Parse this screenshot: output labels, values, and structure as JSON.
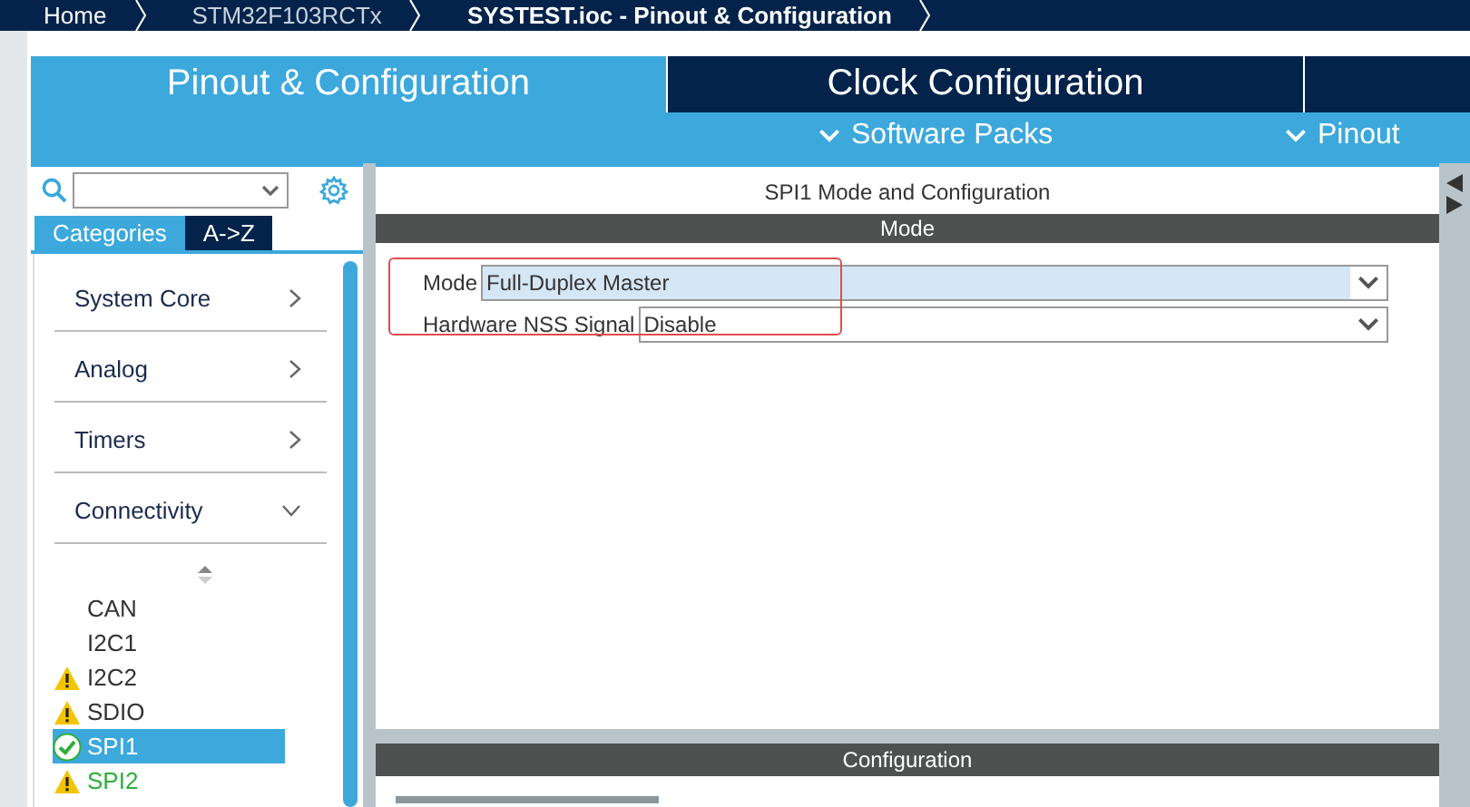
{
  "breadcrumbs": [
    {
      "label": "Home",
      "selected": false
    },
    {
      "label": "STM32F103RCTx",
      "selected": false
    },
    {
      "label": "SYSTEST.ioc - Pinout & Configuration",
      "selected": true
    }
  ],
  "tabs": [
    {
      "label": "Pinout & Configuration",
      "selected": true
    },
    {
      "label": "Clock Configuration",
      "selected": false
    }
  ],
  "menus": [
    "Software Packs",
    "Pinout"
  ],
  "sidebar": {
    "view_tabs": [
      {
        "label": "Categories",
        "selected": true
      },
      {
        "label": "A->Z",
        "selected": false
      }
    ],
    "categories": [
      {
        "label": "System Core",
        "expanded": false
      },
      {
        "label": "Analog",
        "expanded": false
      },
      {
        "label": "Timers",
        "expanded": false
      },
      {
        "label": "Connectivity",
        "expanded": true,
        "children": [
          {
            "label": "CAN",
            "warning": false,
            "ok": false,
            "configured": false,
            "selected": false
          },
          {
            "label": "I2C1",
            "warning": false,
            "ok": false,
            "configured": false,
            "selected": false
          },
          {
            "label": "I2C2",
            "warning": true,
            "ok": false,
            "configured": false,
            "selected": false
          },
          {
            "label": "SDIO",
            "warning": true,
            "ok": false,
            "configured": false,
            "selected": false
          },
          {
            "label": "SPI1",
            "warning": false,
            "ok": true,
            "configured": true,
            "selected": true
          },
          {
            "label": "SPI2",
            "warning": true,
            "ok": false,
            "configured": true,
            "selected": false
          }
        ]
      }
    ]
  },
  "panel": {
    "title": "SPI1 Mode and Configuration",
    "mode_section": {
      "title": "Mode",
      "fields": [
        {
          "label": "Mode",
          "value": "Full-Duplex Master",
          "highlighted": true
        },
        {
          "label": "Hardware NSS Signal",
          "value": "Disable",
          "highlighted": false
        }
      ]
    },
    "config_section": {
      "title": "Configuration"
    }
  }
}
